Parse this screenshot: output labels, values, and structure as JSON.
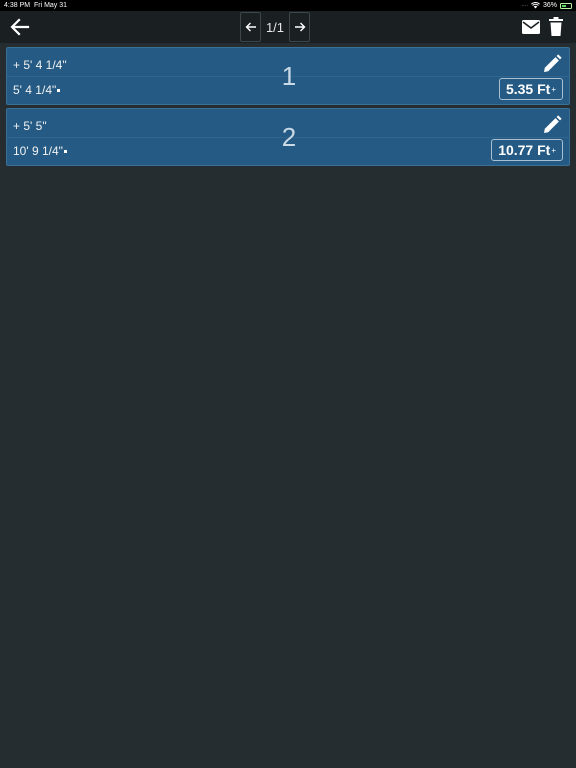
{
  "status_bar": {
    "time": "4:38 PM",
    "date": "Fri May 31",
    "battery": "36%"
  },
  "toolbar": {
    "page_label": "1/1"
  },
  "icons": {
    "back": "arrow-left-icon",
    "prev": "arrow-left-icon",
    "next": "arrow-right-icon",
    "mail": "mail-icon",
    "trash": "trash-icon",
    "edit": "pencil-icon"
  },
  "entries": [
    {
      "number": "1",
      "added": "+ 5' 4 1/4\"",
      "running": "5' 4 1/4\"",
      "total": "5.35 Ft",
      "total_suffix": "+"
    },
    {
      "number": "2",
      "added": "+ 5' 5\"",
      "running": "10' 9 1/4\"",
      "total": "10.77 Ft",
      "total_suffix": "+"
    }
  ],
  "colors": {
    "background": "#252d31",
    "card": "#245a83",
    "toolbar": "#1a1f22"
  }
}
